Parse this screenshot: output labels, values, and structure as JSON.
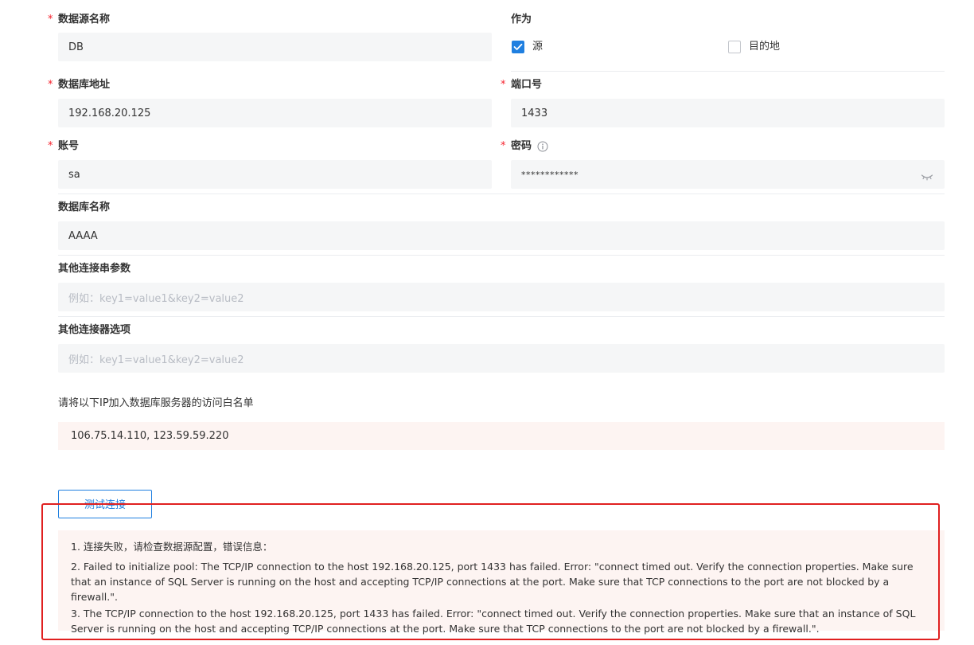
{
  "form": {
    "datasource_name": {
      "label": "数据源名称",
      "value": "DB"
    },
    "role": {
      "label": "作为",
      "source": {
        "label": "源",
        "checked": true
      },
      "target": {
        "label": "目的地",
        "checked": false
      }
    },
    "db_address": {
      "label": "数据库地址",
      "value": "192.168.20.125"
    },
    "port": {
      "label": "端口号",
      "value": "1433"
    },
    "account": {
      "label": "账号",
      "value": "sa"
    },
    "password": {
      "label": "密码",
      "value": "************"
    },
    "db_name": {
      "label": "数据库名称",
      "value": "AAAA"
    },
    "conn_params": {
      "label": "其他连接串参数",
      "value": "",
      "placeholder": "例如：key1=value1&key2=value2"
    },
    "connector_options": {
      "label": "其他连接器选项",
      "value": "",
      "placeholder": "例如：key1=value1&key2=value2"
    },
    "whitelist": {
      "label": "请将以下IP加入数据库服务器的访问白名单",
      "value": "106.75.14.110, 123.59.59.220"
    }
  },
  "test_button": {
    "label": "测试连接"
  },
  "error": {
    "lines": [
      "1. 连接失败，请检查数据源配置，错误信息：",
      "2. Failed to initialize pool: The TCP/IP connection to the host 192.168.20.125, port 1433 has failed. Error: \"connect timed out. Verify the connection properties. Make sure that an instance of SQL Server is running on the host and accepting TCP/IP connections at the port. Make sure that TCP connections to the port are not blocked by a firewall.\".",
      "3. The TCP/IP connection to the host 192.168.20.125, port 1433 has failed. Error: \"connect timed out. Verify the connection properties. Make sure that an instance of SQL Server is running on the host and accepting TCP/IP connections at the port. Make sure that TCP connections to the port are not blocked by a firewall.\"."
    ]
  },
  "colors": {
    "primary": "#1f7fe0",
    "required": "#f5222d",
    "error_bg": "#fdf4f2",
    "highlight_outline": "#e02020"
  },
  "icons": {
    "password_info": "info-circle-icon",
    "password_toggle": "eye-closed-icon",
    "checkbox_checked": "checkmark-icon"
  }
}
